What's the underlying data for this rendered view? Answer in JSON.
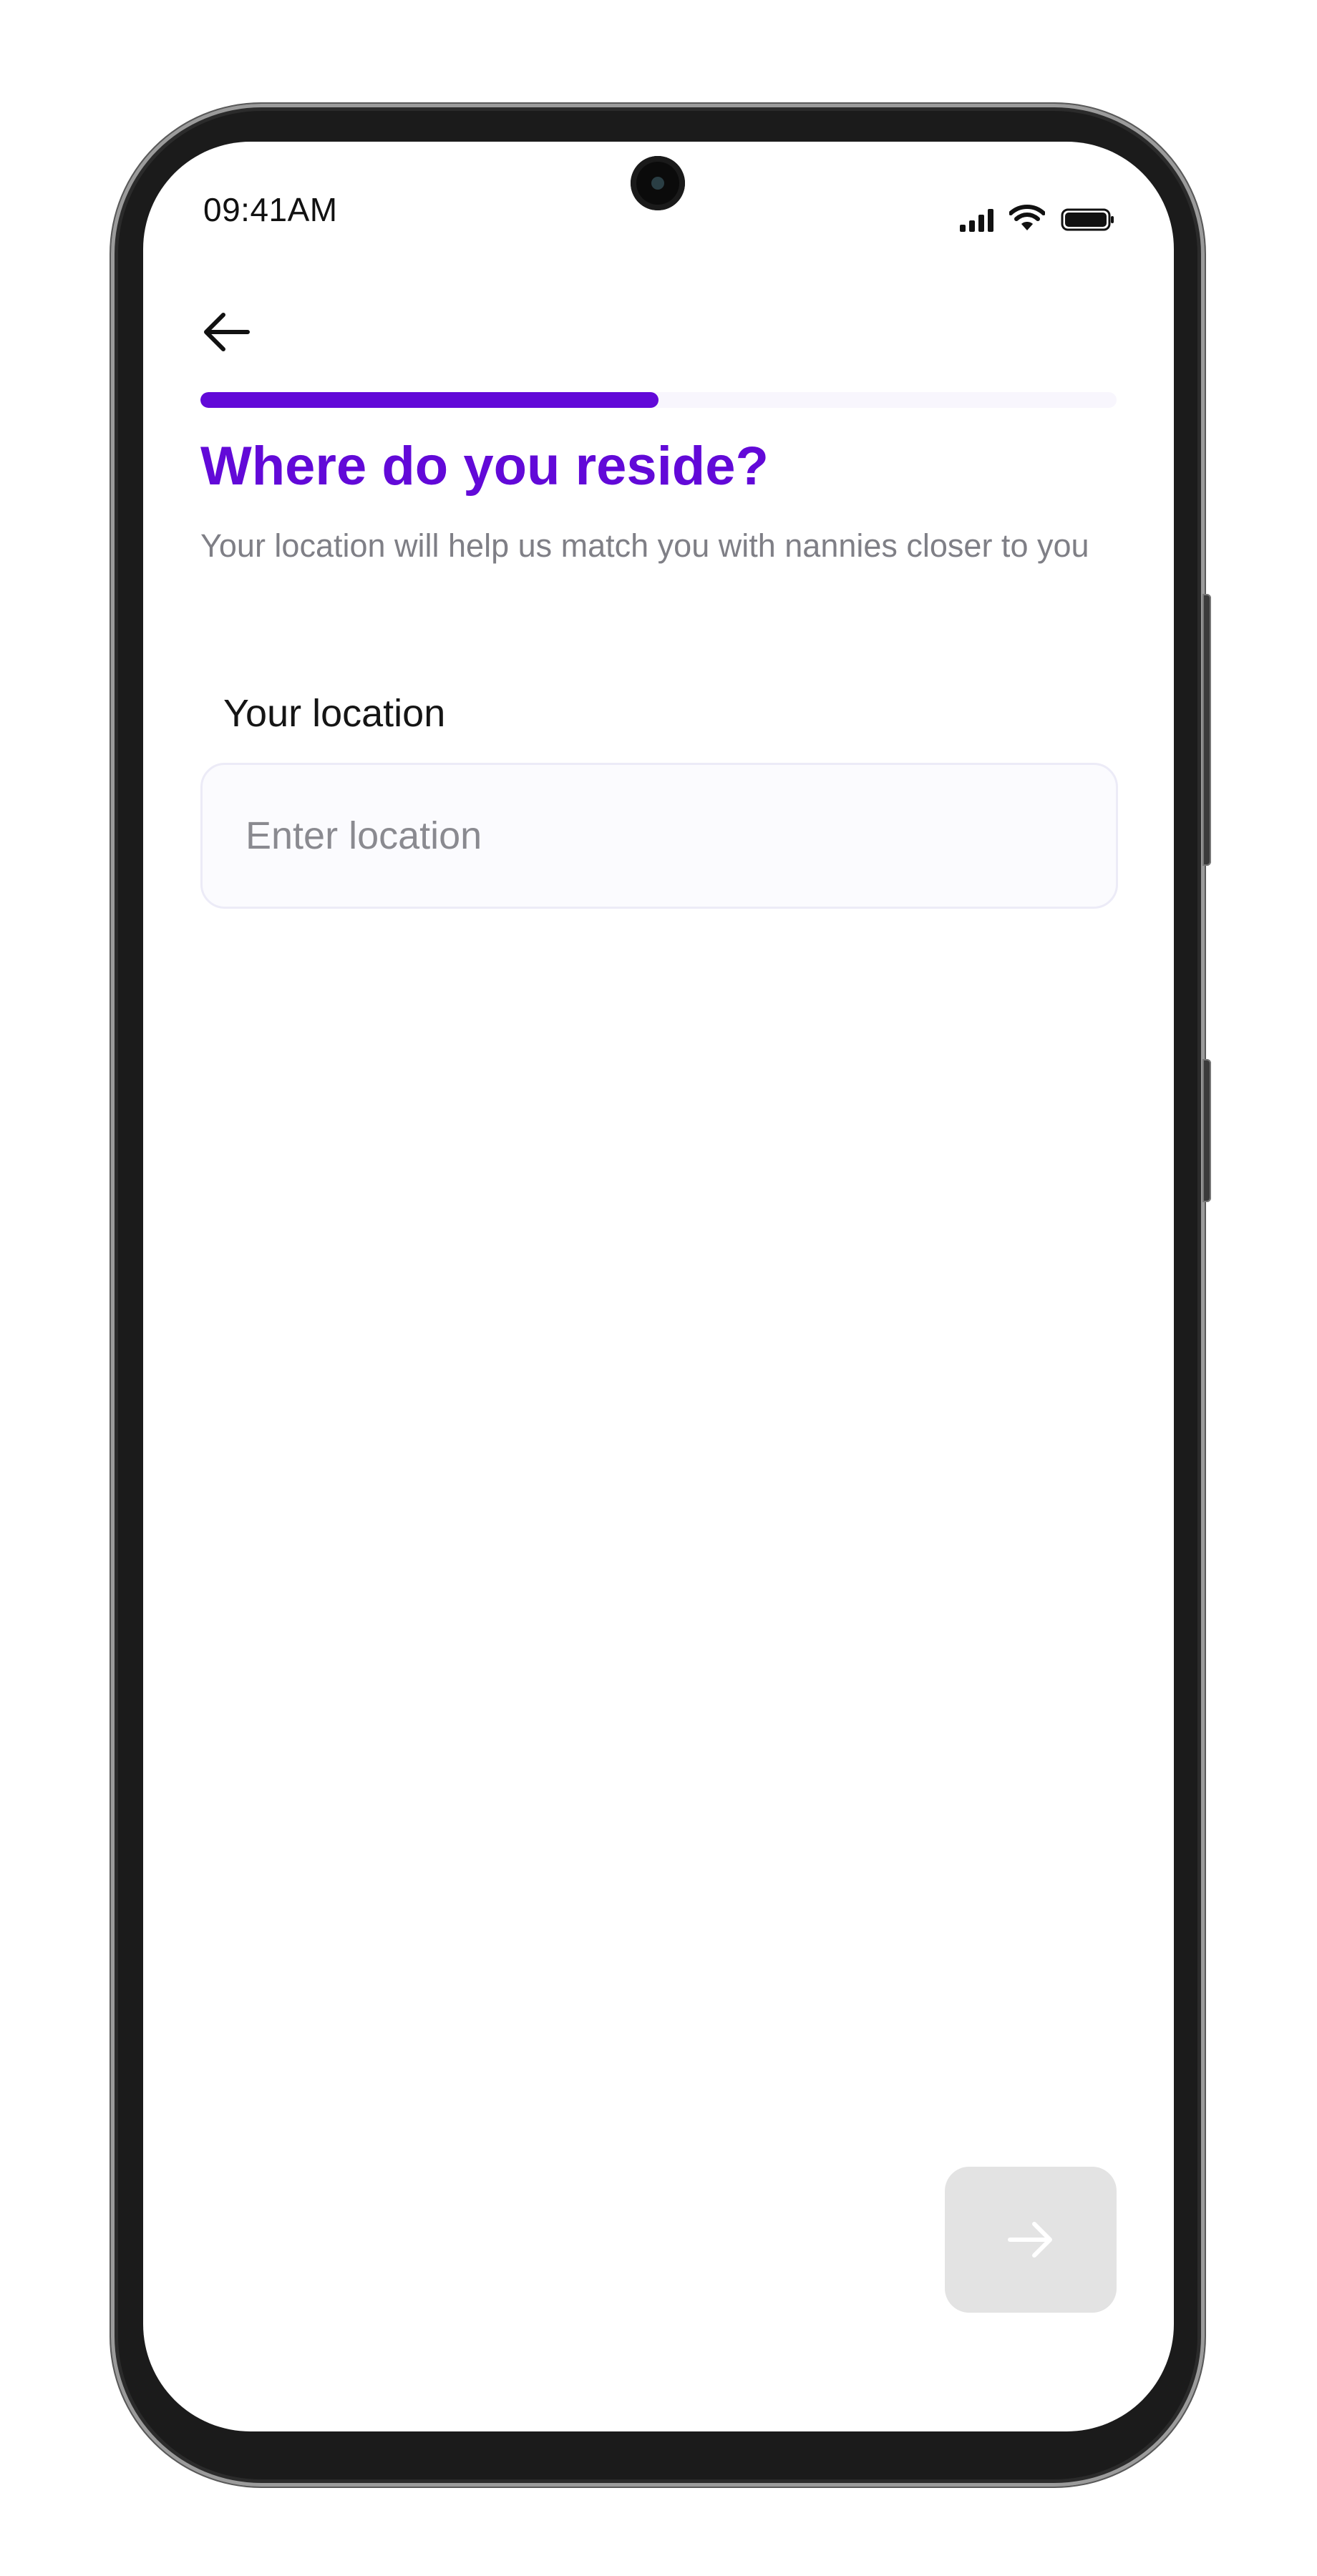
{
  "status_bar": {
    "time": "09:41AM",
    "icons": [
      "signal-icon",
      "wifi-icon",
      "battery-icon"
    ]
  },
  "header": {
    "back_icon": "arrow-left-icon",
    "progress_fraction": 0.5
  },
  "main": {
    "title": "Where do you reside?",
    "subtitle": "Your location will help us match you with nannies closer to you",
    "location_field": {
      "label": "Your location",
      "placeholder": "Enter location",
      "value": ""
    }
  },
  "footer": {
    "next_icon": "arrow-right-icon",
    "next_enabled": false
  },
  "colors": {
    "accent": "#6209D8",
    "title": "#6209D8",
    "subtitle": "#7F7F86",
    "input_background": "#FBFBFE",
    "input_border": "#ECEBF7",
    "progress_track": "#F8F6FD",
    "disabled_button": "#E3E3E3"
  }
}
